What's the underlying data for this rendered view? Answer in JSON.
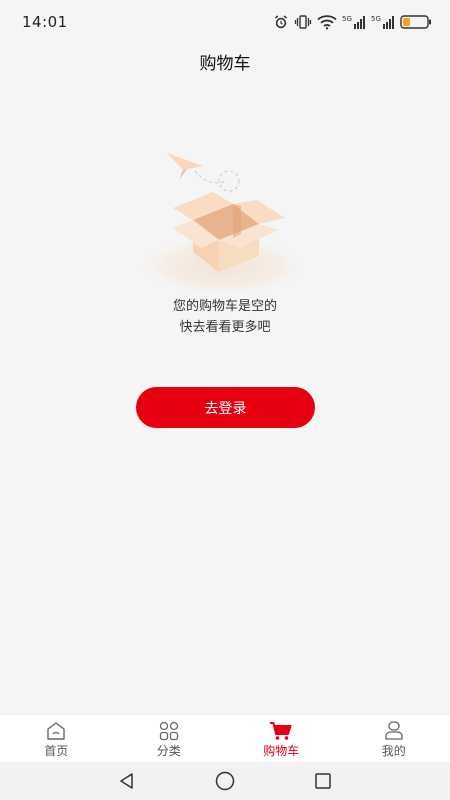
{
  "status_bar": {
    "time": "14:01",
    "icons": [
      "alarm-icon",
      "vibrate-icon",
      "wifi-icon",
      "signal-5g-icon",
      "signal-5g-icon",
      "battery-icon"
    ],
    "network_1": "5G",
    "network_2": "5G"
  },
  "header": {
    "title": "购物车"
  },
  "empty_state": {
    "illustration": "empty-box-with-paper-plane",
    "line1": "您的购物车是空的",
    "line2": "快去看看更多吧"
  },
  "login_button": {
    "label": "去登录"
  },
  "tab_bar": {
    "items": [
      {
        "label": "首页",
        "icon": "home-icon",
        "active": false
      },
      {
        "label": "分类",
        "icon": "category-icon",
        "active": false
      },
      {
        "label": "购物车",
        "icon": "cart-icon",
        "active": true
      },
      {
        "label": "我的",
        "icon": "profile-icon",
        "active": false
      }
    ]
  },
  "nav_bar": {
    "buttons": [
      "back-icon",
      "home-circle-icon",
      "recents-icon"
    ]
  },
  "colors": {
    "accent": "#e60012",
    "background": "#f5f5f5",
    "box": "#f6d2b3"
  }
}
